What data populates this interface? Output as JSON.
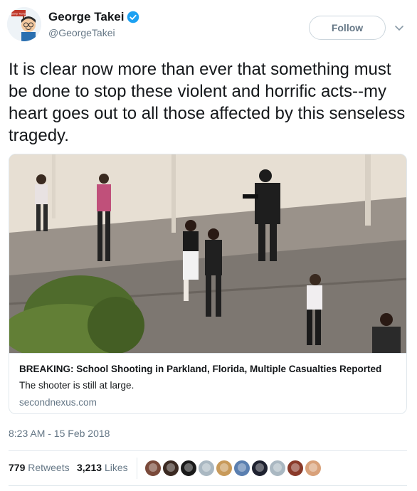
{
  "tweet": {
    "author": {
      "display_name": "George Takei",
      "handle": "@GeorgeTakei",
      "verified": true,
      "avatar_sign_text": "Dump Trump"
    },
    "follow_label": "Follow",
    "text": "It is clear now more than ever that something must be done to stop these violent and horrific acts--my heart goes out to all those affected by this senseless tragedy.",
    "card": {
      "title": "BREAKING: School Shooting in Parkland, Florida, Multiple Casualties Reported",
      "description": "The shooter is still at large.",
      "domain": "secondnexus.com"
    },
    "timestamp": "8:23 AM - 15 Feb 2018",
    "stats": {
      "retweets_count": "779",
      "retweets_label": "Retweets",
      "likes_count": "3,213",
      "likes_label": "Likes"
    },
    "likers": [
      {
        "color": "#7a4a3a"
      },
      {
        "color": "#3b2a22"
      },
      {
        "color": "#1a1a1a"
      },
      {
        "color": "#aab8c2"
      },
      {
        "color": "#c89a5a"
      },
      {
        "color": "#5a7fb0"
      },
      {
        "color": "#1f2230"
      },
      {
        "color": "#aab8c2"
      },
      {
        "color": "#8a3a2a"
      },
      {
        "color": "#d9a17a"
      }
    ]
  },
  "colors": {
    "text": "#14171a",
    "secondary": "#657786",
    "border": "#e1e8ed",
    "verified_blue": "#1da1f2"
  }
}
